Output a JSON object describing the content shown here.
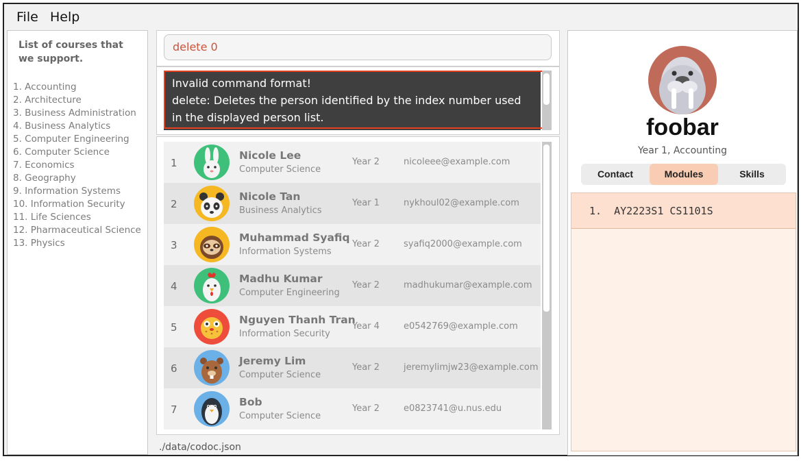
{
  "menu": {
    "file": "File",
    "help": "Help"
  },
  "courses": {
    "heading": "List of courses that we support.",
    "items": [
      "1. Accounting",
      "2. Architecture",
      "3. Business Administration",
      "4. Business Analytics",
      "5. Computer Engineering",
      "6. Computer Science",
      "7. Economics",
      "8. Geography",
      "9. Information Systems",
      "10. Information Security",
      "11. Life Sciences",
      "12. Pharmaceutical Science",
      "13. Physics"
    ]
  },
  "command": {
    "value": "delete 0"
  },
  "result": {
    "line1": "Invalid command format!",
    "line2": "delete: Deletes the person identified by the index number used",
    "line3": "in the displayed person list."
  },
  "persons": [
    {
      "index": "1",
      "name": "Nicole Lee",
      "course": "Computer Science",
      "year": "Year 2",
      "email": "nicoleee@example.com",
      "avatar": "rabbit-icon"
    },
    {
      "index": "2",
      "name": "Nicole Tan",
      "course": "Business Analytics",
      "year": "Year 1",
      "email": "nykhoul02@example.com",
      "avatar": "panda-icon"
    },
    {
      "index": "3",
      "name": "Muhammad Syafiq",
      "course": "Information Systems",
      "year": "Year 2",
      "email": "syafiq2000@example.com",
      "avatar": "sloth-icon"
    },
    {
      "index": "4",
      "name": "Madhu Kumar",
      "course": "Computer Engineering",
      "year": "Year 2",
      "email": "madhukumar@example.com",
      "avatar": "chicken-icon"
    },
    {
      "index": "5",
      "name": "Nguyen Thanh Tran",
      "course": "Information Security",
      "year": "Year 4",
      "email": "e0542769@example.com",
      "avatar": "pufferfish-icon"
    },
    {
      "index": "6",
      "name": "Jeremy Lim",
      "course": "Computer Science",
      "year": "Year 2",
      "email": "jeremylimjw23@example.com",
      "avatar": "beaver-icon"
    },
    {
      "index": "7",
      "name": "Bob",
      "course": "Computer Science",
      "year": "Year 2",
      "email": "e0823741@u.nus.edu",
      "avatar": "penguin-icon"
    }
  ],
  "status": {
    "path": "./data/codoc.json"
  },
  "profile": {
    "name": "foobar",
    "subtitle": "Year 1, Accounting",
    "avatar": "walrus-icon",
    "tabs": [
      "Contact",
      "Modules",
      "Skills"
    ],
    "active_tab": "Modules",
    "modules": [
      "1.  AY2223S1 CS1101S"
    ]
  },
  "colors": {
    "accent": "#f9cdb4",
    "error_border": "#e6401f",
    "command_text": "#c8563d",
    "result_bg": "#3f3f3f"
  }
}
